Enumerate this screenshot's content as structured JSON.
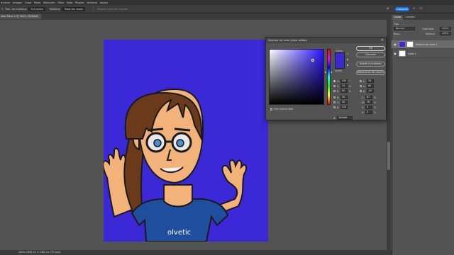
{
  "menu": [
    "Archivo",
    "Imagen",
    "Capa",
    "Texto",
    "Selección",
    "Filtro",
    "Vista",
    "Plugins",
    "Ventana",
    "Ayuda"
  ],
  "options": {
    "tool_label": "Tam. de muestra:",
    "tool_value": "3x3 pixels",
    "sample_label": "Muestra:",
    "sample_value": "Todas las capas",
    "ring_label": "Mostrar anillo de muestra",
    "share_label": "Compartir"
  },
  "document": {
    "tab_title": "robo Moro × @ 100% (RGB/8#)"
  },
  "status": {
    "text": "100%   2362 px × 2362 px (72 ppp)"
  },
  "right_panel": {
    "tabs": [
      "Capas",
      "Canales"
    ],
    "kind_label": "Tipo",
    "mode_value": "Normal",
    "opacity_label": "Opacidad:",
    "opacity_value": "100%",
    "lock_label": "Bloq.:",
    "fill_label": "Relleno:",
    "fill_value": "100%",
    "layers": [
      {
        "name": "Relleno de color 1",
        "selected": true
      },
      {
        "name": "Capa 1",
        "selected": false
      }
    ]
  },
  "color_picker": {
    "title": "Selector de color (color sólido)",
    "new_label": "nuevo",
    "current_label": "actual",
    "ok_label": "OK",
    "cancel_label": "Cancelar",
    "add_swatch_label": "Añadir a muestras",
    "libraries_label": "Bibliotecas de colores",
    "web_only_label": "Sólo colores Web",
    "hex_label": "#",
    "hex_value": "3b28d6",
    "colors": {
      "accent": "#3b28d6"
    },
    "fields": {
      "H": {
        "value": "245",
        "unit": "°"
      },
      "S": {
        "value": "74",
        "unit": "%"
      },
      "B": {
        "value": "84",
        "unit": "%"
      },
      "R": {
        "value": "59",
        "unit": ""
      },
      "G": {
        "value": "40",
        "unit": ""
      },
      "Bl": {
        "value": "214",
        "unit": ""
      },
      "L": {
        "value": "33",
        "unit": ""
      },
      "a": {
        "value": "65",
        "unit": ""
      },
      "b": {
        "value": "-92",
        "unit": ""
      },
      "C": {
        "value": "87",
        "unit": "%"
      },
      "M": {
        "value": "76",
        "unit": "%"
      },
      "Y": {
        "value": "0",
        "unit": "%"
      },
      "K": {
        "value": "0",
        "unit": "%"
      }
    }
  },
  "canvas": {
    "background": "#3b28d6",
    "shirt_text": "olvetic"
  }
}
